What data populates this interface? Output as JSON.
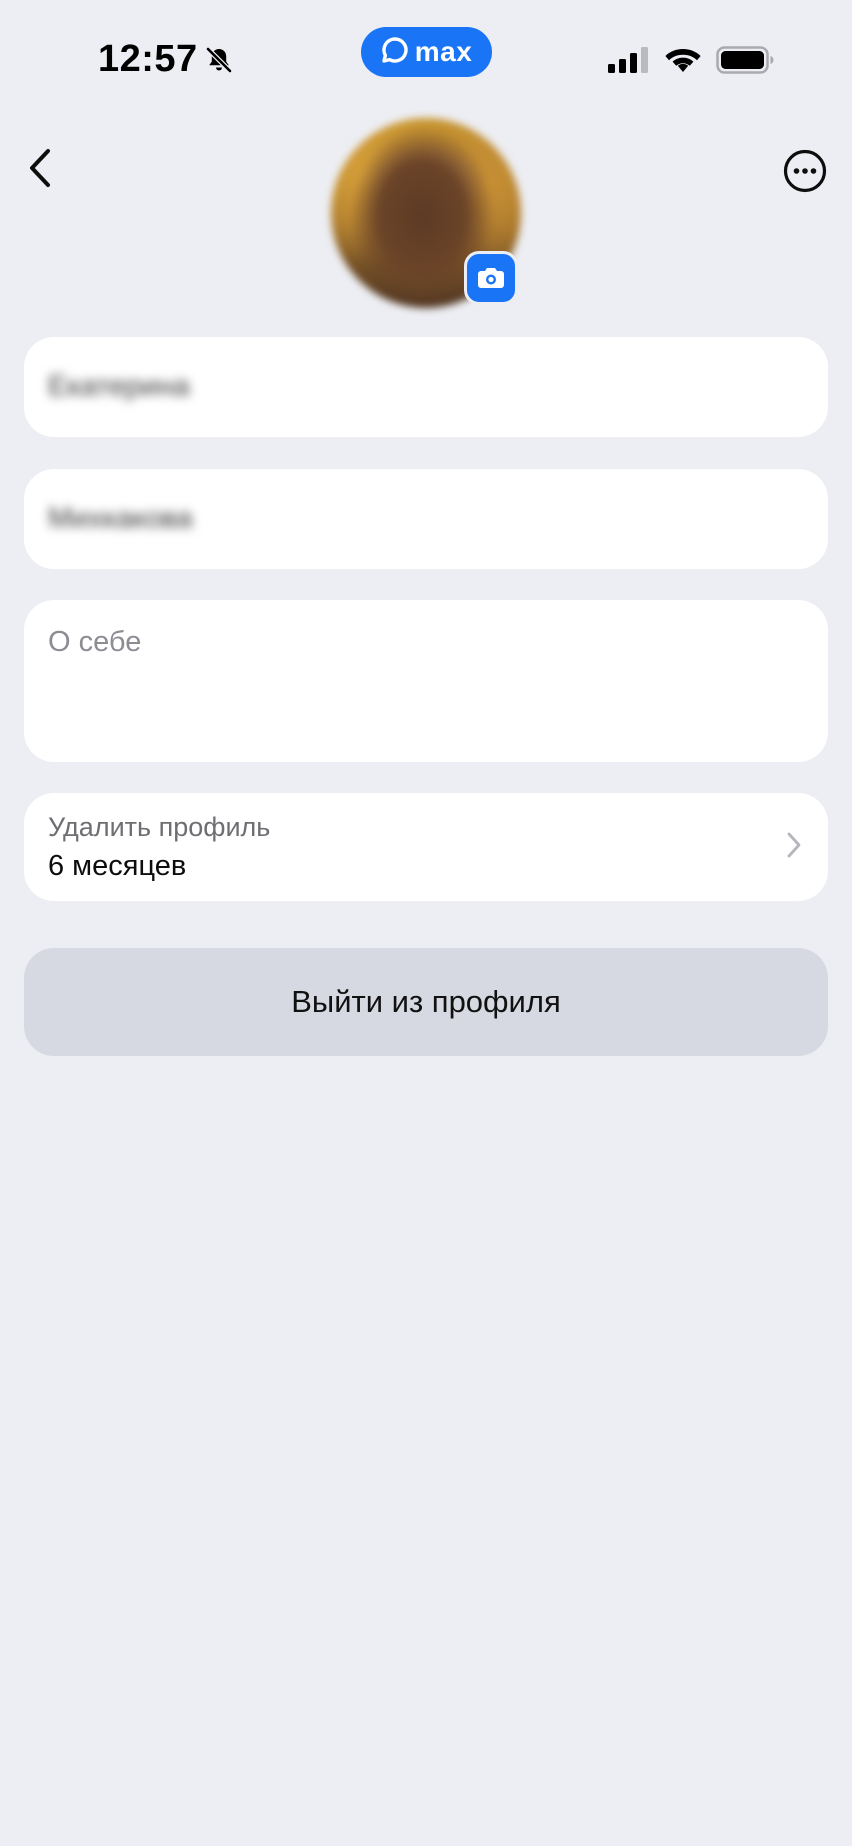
{
  "status_bar": {
    "time": "12:57",
    "app_pill_label": "max",
    "accent_color": "#1A75F6",
    "icons": [
      "bell-slash-icon",
      "cellular-signal-icon",
      "wifi-icon",
      "battery-icon"
    ]
  },
  "header": {
    "back_icon": "chevron-left-icon",
    "more_icon": "ellipsis-circle-icon"
  },
  "avatar": {
    "badge_icon": "camera-icon"
  },
  "profile": {
    "first_name": "Екатерина",
    "last_name": "Михкакова",
    "about_placeholder": "О себе"
  },
  "delete_profile": {
    "label": "Удалить профиль",
    "value": "6 месяцев"
  },
  "logout": {
    "label": "Выйти из профиля"
  }
}
